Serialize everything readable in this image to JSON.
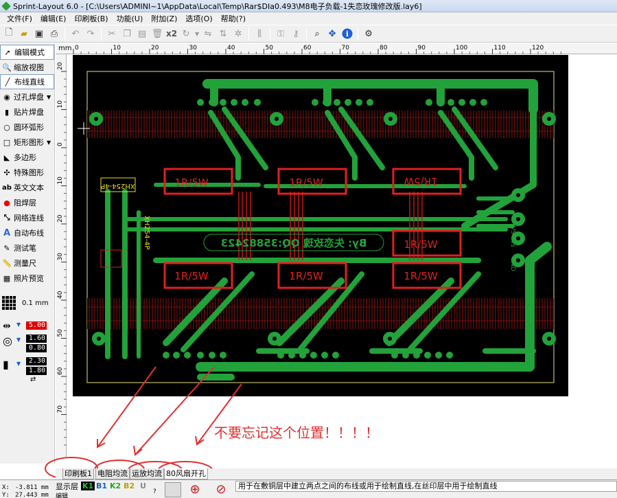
{
  "window": {
    "title": "Sprint-Layout 6.0 - [C:\\Users\\ADMINI~1\\AppData\\Local\\Temp\\Rar$DIa0.493\\M8电子负载-1失恋玫瑰修改版.lay6]"
  },
  "menu": [
    "文件(F)",
    "编辑(E)",
    "印刷板(B)",
    "功能(U)",
    "附加(Z)",
    "选项(O)",
    "帮助(?)"
  ],
  "toolbar": {
    "multiply_label": "x2",
    "icons": [
      "new-file-icon",
      "open-folder-icon",
      "save-icon",
      "print-icon",
      "undo-icon",
      "redo-icon",
      "cut-icon",
      "copy-icon",
      "paste-icon",
      "delete-icon",
      "duplicate-icon",
      "rotate-icon",
      "mirror-h-icon",
      "mirror-v-icon",
      "align-icon",
      "group-icon",
      "ungroup-icon",
      "lock-icon",
      "unlock-icon",
      "zoom-icon",
      "move-icon",
      "info-icon",
      "settings-icon"
    ]
  },
  "tools": [
    {
      "label": "编辑模式",
      "icon": "arrow-pointer-icon",
      "active": true
    },
    {
      "label": "缩放视图",
      "icon": "magnifier-icon"
    },
    {
      "label": "布线直线",
      "icon": "track-pen-icon"
    },
    {
      "label": "过孔焊盘",
      "icon": "via-pad-icon",
      "dropdown": true
    },
    {
      "label": "贴片焊盘",
      "icon": "smd-pad-icon"
    },
    {
      "label": "圆环弧形",
      "icon": "circle-arc-icon"
    },
    {
      "label": "矩形图形",
      "icon": "rectangle-icon",
      "dropdown": true
    },
    {
      "label": "多边形",
      "icon": "polygon-icon"
    },
    {
      "label": "特殊图形",
      "icon": "special-shape-icon"
    },
    {
      "label": "英文文本",
      "icon": "text-ab-icon"
    },
    {
      "label": "阻焊层",
      "icon": "solder-mask-icon"
    },
    {
      "label": "网络连线",
      "icon": "netlist-icon"
    },
    {
      "label": "自动布线",
      "icon": "autoroute-icon"
    },
    {
      "label": "测试笔",
      "icon": "test-probe-icon"
    },
    {
      "label": "测量尺",
      "icon": "ruler-icon"
    },
    {
      "label": "照片预览",
      "icon": "photo-preview-icon"
    }
  ],
  "grid": {
    "value": "0.1 mm"
  },
  "params": {
    "track_width": "5.00",
    "pad_outer": "1.60",
    "pad_inner": "0.80",
    "smd_w": "2.30",
    "smd_h": "1.80"
  },
  "ruler": {
    "unit": "mm",
    "top_ticks": [
      "0",
      "10",
      "20",
      "30",
      "40",
      "50",
      "60",
      "70",
      "80",
      "90",
      "100",
      "110",
      "120"
    ],
    "left_ticks": [
      "20",
      "10",
      "0",
      "10",
      "20",
      "30",
      "40",
      "50",
      "60",
      "70"
    ]
  },
  "board": {
    "resistors": [
      "1R/5W",
      "1R/5W",
      "1R/5W",
      "1R/5W",
      "1R/5W",
      "1R/5W",
      "1R/5W"
    ],
    "conn_top": "XH254-4P",
    "conn_mid": "XH254-4P",
    "signature": "By: 失恋玫瑰 QQ:35882423",
    "right_labels": [
      "VS",
      "Vs",
      "GND"
    ]
  },
  "annotation": {
    "text": "不要忘记这个位置！！！！",
    "color": "#e03030"
  },
  "tabs": [
    "印刷板1",
    "电阻均流",
    "运放均流",
    "80风扇开孔"
  ],
  "status": {
    "x_label": "X:",
    "x_value": "-3.811 mm",
    "y_label": "Y:",
    "y_value": "27.443 mm",
    "layers_label": "显示层",
    "layers": [
      "K1",
      "B1",
      "K2",
      "B2",
      "U"
    ],
    "edit_label": "编辑",
    "hint": "用于在敷铜层中建立两点之间的布线或用于绘制直线,在丝印层中用于绘制直线"
  },
  "colors": {
    "board": "#000000",
    "copper": "#22a23a",
    "silk": "#e02020",
    "outline": "#e8e080",
    "layer_k1": "#22aa22",
    "layer_b1": "#1560d0"
  }
}
